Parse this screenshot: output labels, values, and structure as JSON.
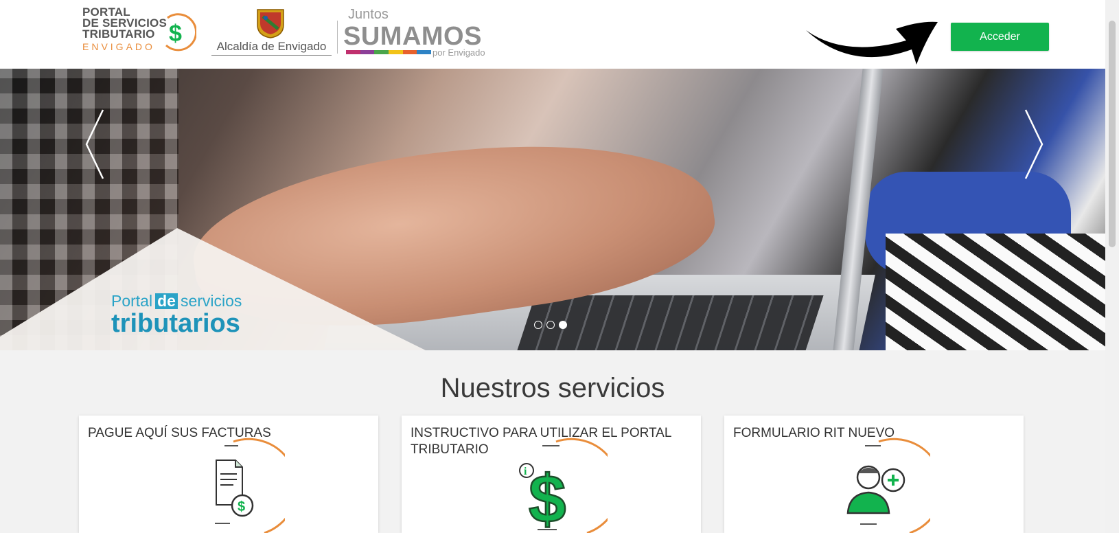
{
  "header": {
    "portal_logo": {
      "line1": "PORTAL",
      "line2": "DE SERVICIOS",
      "line3": "TRIBUTARIO",
      "subline": "ENVIGADO"
    },
    "alcaldia_logo": {
      "text": "Alcaldía de Envigado"
    },
    "juntos_logo": {
      "top": "Juntos",
      "main": "SUMAMOS",
      "bottom": "por Envigado"
    },
    "login_button": "Acceder",
    "colors": {
      "accent_green": "#12b34e",
      "orange": "#e98d3b",
      "teal": "#2aa3c7"
    }
  },
  "hero": {
    "caption_word1": "Portal",
    "caption_de": "de",
    "caption_word2": "servicios",
    "caption_line2": "tributarios",
    "slides": 3,
    "active_slide": 3
  },
  "services": {
    "title": "Nuestros servicios",
    "cards": [
      {
        "title": "PAGUE AQUÍ SUS FACTURAS",
        "icon": "invoice-dollar-icon"
      },
      {
        "title": "INSTRUCTIVO PARA UTILIZAR EL PORTAL TRIBUTARIO",
        "icon": "info-dollar-icon"
      },
      {
        "title": "FORMULARIO RIT NUEVO",
        "icon": "add-user-icon"
      }
    ]
  }
}
